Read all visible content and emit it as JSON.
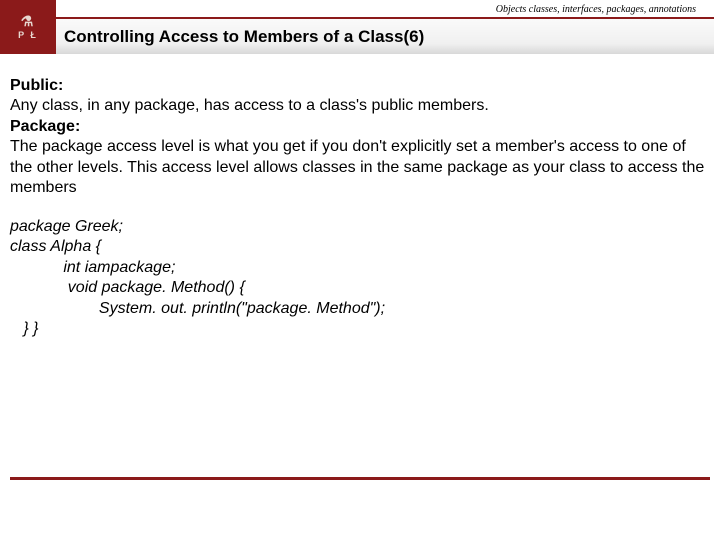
{
  "header": {
    "breadcrumb": "Objects classes, interfaces, packages, annotations",
    "logo_letters": "P   Ł",
    "logo_symbol": "⚗",
    "title": "Controlling Access to Members of a Class(6)"
  },
  "body": {
    "public_label": "Public:",
    "public_text": "Any class, in any package, has access to a class's public members.",
    "package_label": "Package:",
    "package_text": "The package access level is what you get if you don't explicitly set a member's access to one of the other levels. This access level allows classes in the same package as your class to access the members"
  },
  "code": {
    "l1": "package Greek;",
    "l2": "class Alpha {",
    "l3": "            int iampackage;",
    "l4": "             void package. Method() {",
    "l5": "                    System. out. println(\"package. Method\");",
    "l6": "   } }"
  }
}
